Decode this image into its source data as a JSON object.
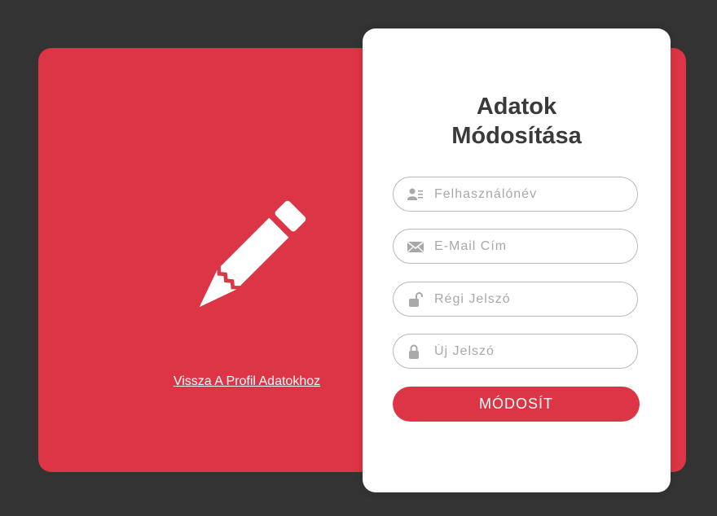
{
  "left_panel": {
    "back_link_label": "Vissza A Profil Adatokhoz",
    "icon": "pencil-icon"
  },
  "form": {
    "title_line1": "Adatok",
    "title_line2": "Módosítása",
    "fields": [
      {
        "icon": "user-card-icon",
        "placeholder": "Felhasználónév",
        "value": ""
      },
      {
        "icon": "envelope-icon",
        "placeholder": "E-Mail Cím",
        "value": ""
      },
      {
        "icon": "unlock-icon",
        "placeholder": "Régi Jelszó",
        "value": ""
      },
      {
        "icon": "lock-icon",
        "placeholder": "Új Jelszó",
        "value": ""
      }
    ],
    "submit_label": "MÓDOSÍT"
  },
  "colors": {
    "background": "#333333",
    "accent": "#dc3545",
    "card": "#ffffff",
    "title": "#3a3a3a",
    "icon_gray": "#a8a8a8"
  }
}
